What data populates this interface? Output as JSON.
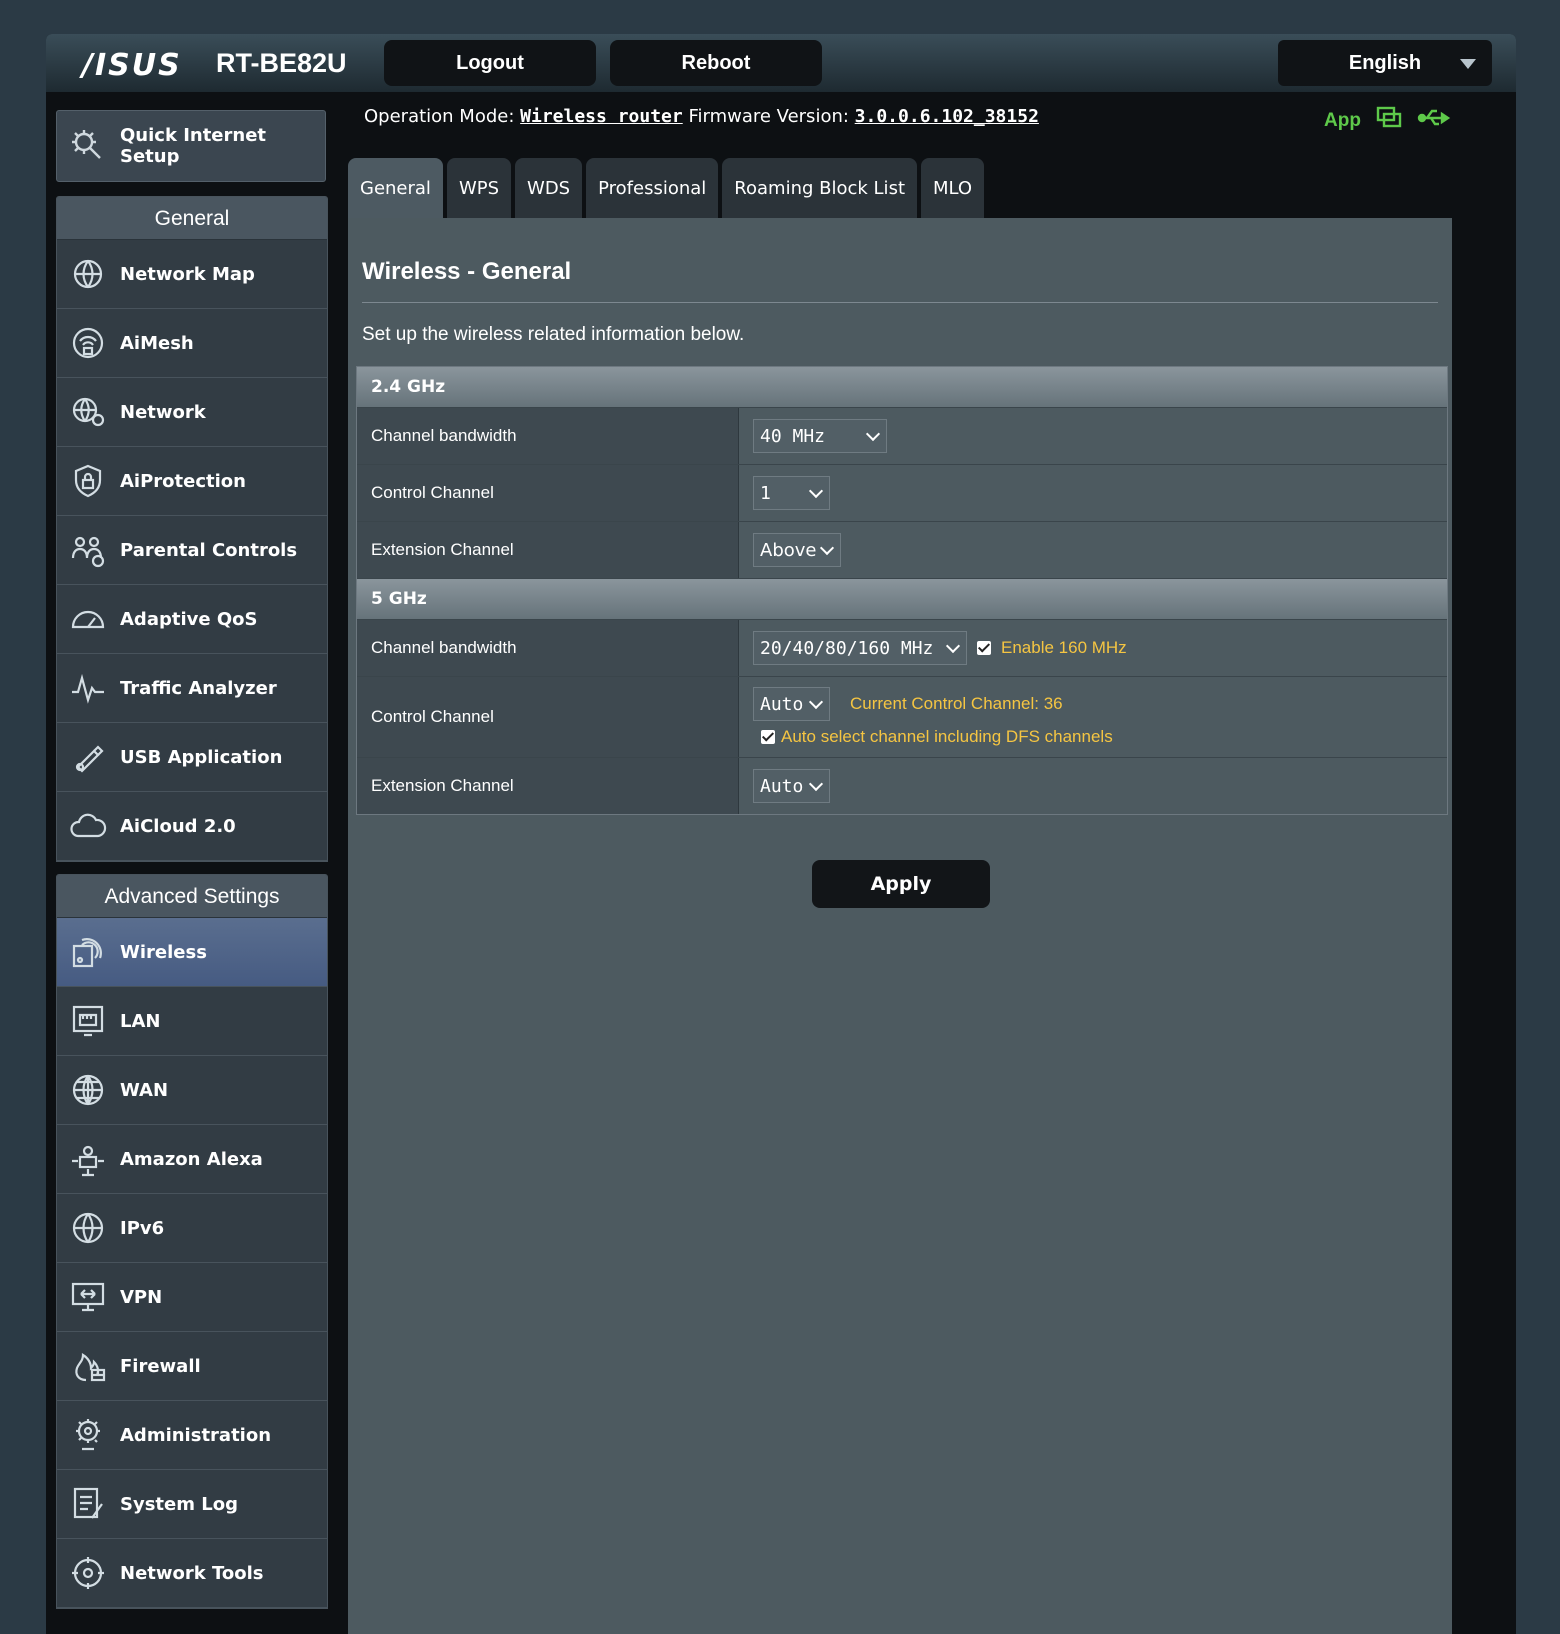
{
  "header": {
    "logo": "/ISUS",
    "model": "RT-BE82U",
    "logout_label": "Logout",
    "reboot_label": "Reboot",
    "language": "English"
  },
  "status": {
    "opmode_label": "Operation Mode:",
    "opmode_value": "Wireless router",
    "firmware_label": "Firmware Version:",
    "firmware_value": "3.0.0.6.102_38152",
    "app_label": "App"
  },
  "sidebar": {
    "qis_label_1": "Quick Internet",
    "qis_label_2": "Setup",
    "general_title": "General",
    "general_items": [
      {
        "label": "Network Map",
        "icon": "network-map-icon"
      },
      {
        "label": "AiMesh",
        "icon": "aimesh-icon"
      },
      {
        "label": "Network",
        "icon": "network-icon"
      },
      {
        "label": "AiProtection",
        "icon": "aiprotection-icon"
      },
      {
        "label": "Parental Controls",
        "icon": "parental-controls-icon"
      },
      {
        "label": "Adaptive QoS",
        "icon": "adaptive-qos-icon"
      },
      {
        "label": "Traffic Analyzer",
        "icon": "traffic-analyzer-icon"
      },
      {
        "label": "USB Application",
        "icon": "usb-application-icon"
      },
      {
        "label": "AiCloud 2.0",
        "icon": "aicloud-icon"
      }
    ],
    "advanced_title": "Advanced Settings",
    "advanced_items": [
      {
        "label": "Wireless",
        "icon": "wireless-icon",
        "active": true
      },
      {
        "label": "LAN",
        "icon": "lan-icon"
      },
      {
        "label": "WAN",
        "icon": "wan-icon"
      },
      {
        "label": "Amazon Alexa",
        "icon": "alexa-icon"
      },
      {
        "label": "IPv6",
        "icon": "ipv6-icon"
      },
      {
        "label": "VPN",
        "icon": "vpn-icon"
      },
      {
        "label": "Firewall",
        "icon": "firewall-icon"
      },
      {
        "label": "Administration",
        "icon": "administration-icon"
      },
      {
        "label": "System Log",
        "icon": "system-log-icon"
      },
      {
        "label": "Network Tools",
        "icon": "network-tools-icon"
      }
    ]
  },
  "tabs": [
    "General",
    "WPS",
    "WDS",
    "Professional",
    "Roaming Block List",
    "MLO"
  ],
  "page": {
    "title": "Wireless - General",
    "description": "Set up the wireless related information below.",
    "apply_label": "Apply"
  },
  "band24": {
    "title": "2.4 GHz",
    "bw_label": "Channel bandwidth",
    "bw_value": "40 MHz",
    "cc_label": "Control Channel",
    "cc_value": "1",
    "ext_label": "Extension Channel",
    "ext_value": "Above"
  },
  "band5": {
    "title": "5 GHz",
    "bw_label": "Channel bandwidth",
    "bw_value": "20/40/80/160 MHz",
    "enable160_label": "Enable 160 MHz",
    "cc_label": "Control Channel",
    "cc_value": "Auto",
    "current_cc": "Current Control Channel: 36",
    "dfs_label": "Auto select channel including DFS channels",
    "ext_label": "Extension Channel",
    "ext_value": "Auto"
  },
  "colors": {
    "accent_active": "#465b82",
    "warning_text": "#f5c542",
    "app_green": "#5ec94a"
  }
}
